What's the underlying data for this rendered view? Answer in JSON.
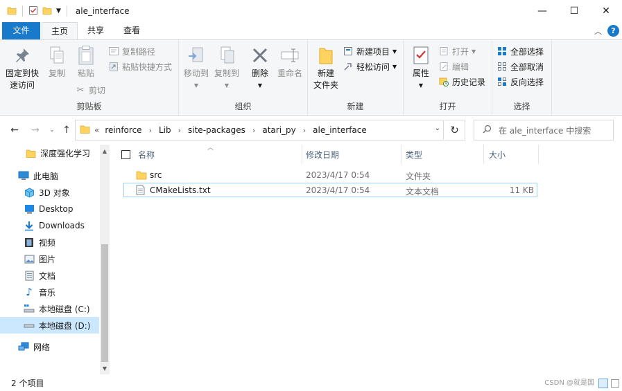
{
  "window": {
    "title": "ale_interface",
    "minimize": "—",
    "maximize": "☐",
    "close": "✕"
  },
  "menu": {
    "tabs": [
      "文件",
      "主页",
      "共享",
      "查看"
    ],
    "active": "主页"
  },
  "ribbon": {
    "clipboard": {
      "label": "剪贴板",
      "pin_line1": "固定到快",
      "pin_line2": "速访问",
      "copy": "复制",
      "paste": "粘贴",
      "copy_path": "复制路径",
      "paste_shortcut": "粘贴快捷方式",
      "cut": "剪切"
    },
    "organize": {
      "label": "组织",
      "move_to": "移动到",
      "copy_to": "复制到",
      "delete": "删除",
      "rename": "重命名"
    },
    "new": {
      "label": "新建",
      "new_folder_line1": "新建",
      "new_folder_line2": "文件夹",
      "new_item": "新建项目",
      "easy_access": "轻松访问"
    },
    "open": {
      "label": "打开",
      "properties": "属性",
      "open": "打开",
      "edit": "编辑",
      "history": "历史记录"
    },
    "select": {
      "label": "选择",
      "select_all": "全部选择",
      "select_none": "全部取消",
      "invert": "反向选择"
    }
  },
  "address": {
    "overflow": "«",
    "crumbs": [
      "reinforce",
      "Lib",
      "site-packages",
      "atari_py",
      "ale_interface"
    ],
    "search_placeholder": "在 ale_interface 中搜索"
  },
  "nav_pane": {
    "items": [
      {
        "label": "深度强化学习",
        "icon": "folder-icon"
      },
      {
        "label": "此电脑",
        "icon": "computer-icon"
      },
      {
        "label": "3D 对象",
        "icon": "3d-objects-icon"
      },
      {
        "label": "Desktop",
        "icon": "desktop-icon"
      },
      {
        "label": "Downloads",
        "icon": "download-icon"
      },
      {
        "label": "视频",
        "icon": "video-icon"
      },
      {
        "label": "图片",
        "icon": "picture-icon"
      },
      {
        "label": "文档",
        "icon": "document-icon"
      },
      {
        "label": "音乐",
        "icon": "music-icon"
      },
      {
        "label": "本地磁盘 (C:)",
        "icon": "drive-c-icon"
      },
      {
        "label": "本地磁盘 (D:)",
        "icon": "drive-d-icon"
      },
      {
        "label": "网络",
        "icon": "network-icon"
      }
    ],
    "selected": "本地磁盘 (D:)"
  },
  "file_list": {
    "columns": [
      "名称",
      "修改日期",
      "类型",
      "大小"
    ],
    "rows": [
      {
        "name": "src",
        "modified": "2023/4/17 0:54",
        "type": "文件夹",
        "size": "",
        "icon": "folder-icon"
      },
      {
        "name": "CMakeLists.txt",
        "modified": "2023/4/17 0:54",
        "type": "文本文档",
        "size": "11 KB",
        "icon": "text-file-icon"
      }
    ]
  },
  "status": {
    "item_count": "2 个项目",
    "watermark": "CSDN @就是国"
  },
  "colors": {
    "accent": "#1979ca",
    "folder": "#ffd35f",
    "selection": "#cce8ff",
    "ribbon_bg": "#f5f6f7"
  }
}
